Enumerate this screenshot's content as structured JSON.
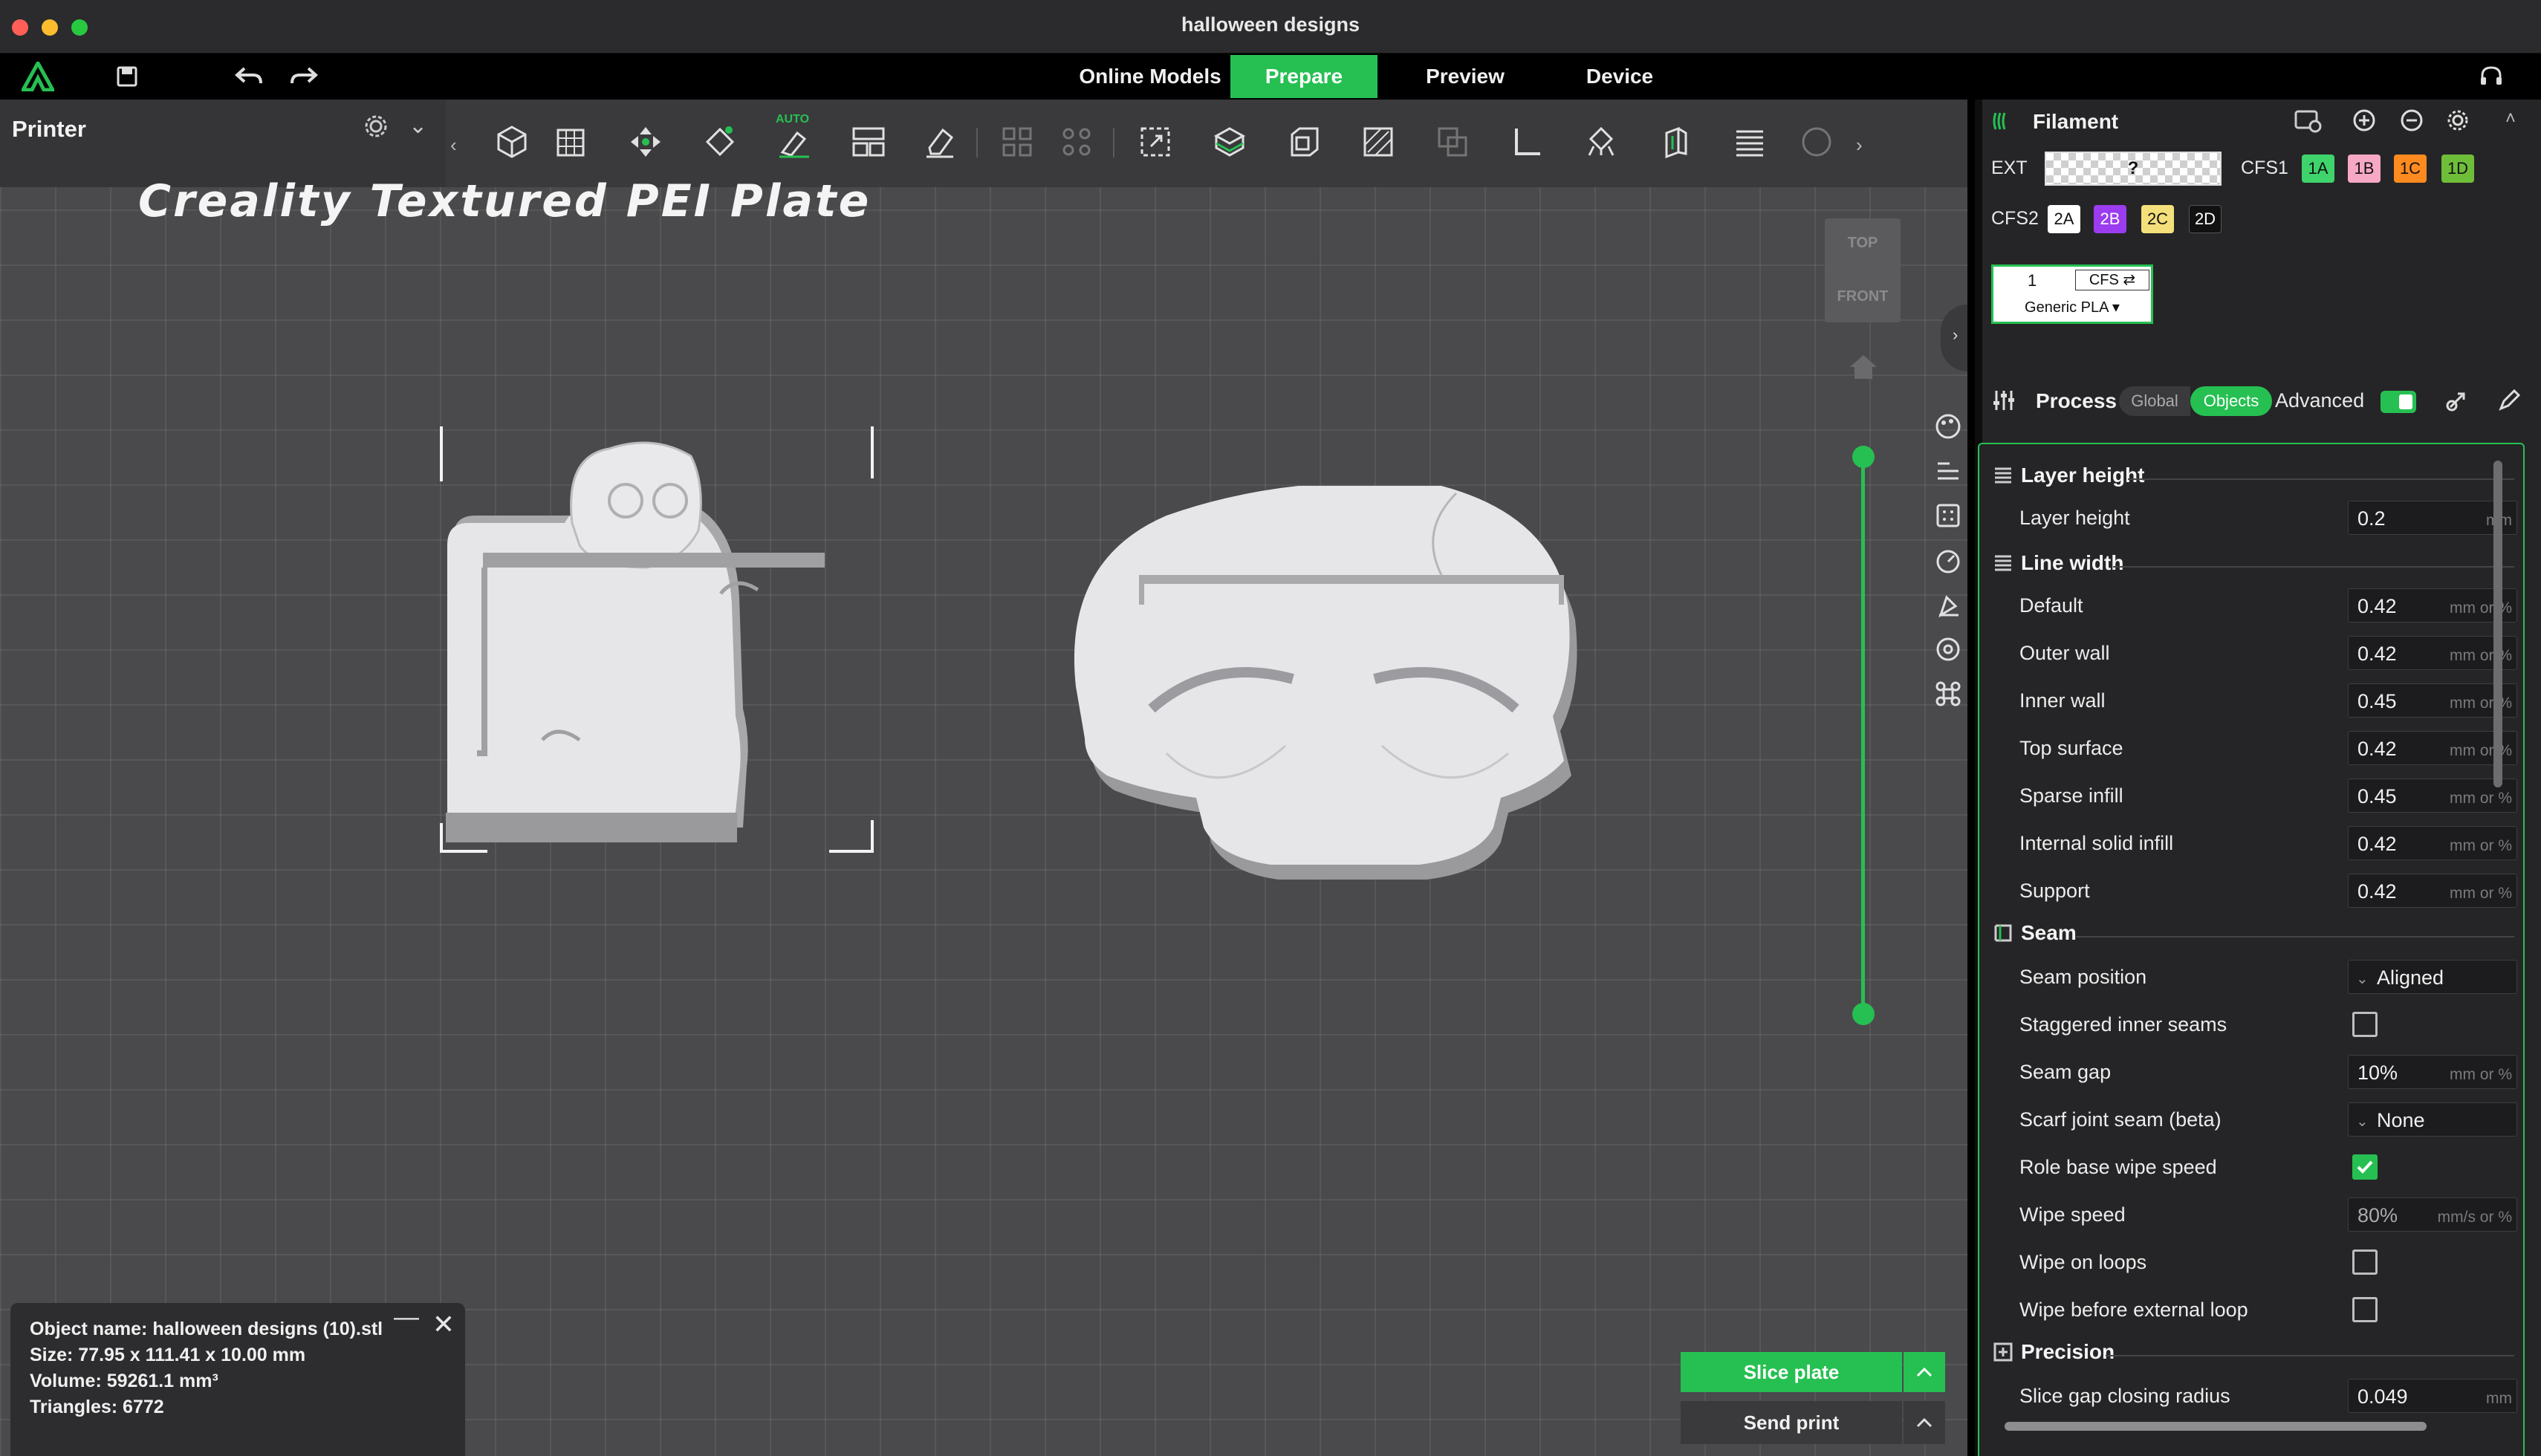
{
  "window": {
    "title": "halloween designs"
  },
  "menubar": {
    "tabs": [
      {
        "label": "Online Models",
        "active": false
      },
      {
        "label": "Prepare",
        "active": true
      },
      {
        "label": "Preview",
        "active": false
      },
      {
        "label": "Device",
        "active": false
      }
    ]
  },
  "printer": {
    "label": "Printer"
  },
  "plate": {
    "name": "Creality Textured PEI Plate"
  },
  "toolbar": {
    "auto_badge": "AUTO"
  },
  "view_cube": {
    "top": "TOP",
    "front": "FRONT"
  },
  "object_info": {
    "name": "Object name: halloween designs (10).stl",
    "size": "Size: 77.95 x 111.41 x 10.00 mm",
    "volume": "Volume: 59261.1 mm³",
    "triangles": "Triangles: 6772"
  },
  "actions": {
    "slice": "Slice plate",
    "send": "Send print"
  },
  "filament": {
    "title": "Filament",
    "ext_label": "EXT",
    "ext_value": "?",
    "cfs1_label": "CFS1",
    "cfs1_slots": [
      {
        "id": "1A",
        "color": "#3fd36b"
      },
      {
        "id": "1B",
        "color": "#f7a8c4"
      },
      {
        "id": "1C",
        "color": "#ff8a1f"
      },
      {
        "id": "1D",
        "color": "#6fbe3a"
      }
    ],
    "cfs2_label": "CFS2",
    "cfs2_slots": [
      {
        "id": "2A",
        "color": "#ffffff"
      },
      {
        "id": "2B",
        "color": "#9b3cf0"
      },
      {
        "id": "2C",
        "color": "#f4e07a"
      },
      {
        "id": "2D",
        "color": "#111111"
      }
    ],
    "card": {
      "number": "1",
      "cfs": "CFS ⇄",
      "name": "Generic PLA ▾"
    }
  },
  "process": {
    "title": "Process",
    "global": "Global",
    "objects": "Objects",
    "advanced": "Advanced",
    "sections": {
      "layer_height": "Layer height",
      "line_width": "Line width",
      "seam": "Seam",
      "precision": "Precision"
    },
    "rows": {
      "layer_height": {
        "label": "Layer height",
        "value": "0.2",
        "unit": "mm"
      },
      "default": {
        "label": "Default",
        "value": "0.42",
        "unit": "mm or %"
      },
      "outer_wall": {
        "label": "Outer wall",
        "value": "0.42",
        "unit": "mm or %"
      },
      "inner_wall": {
        "label": "Inner wall",
        "value": "0.45",
        "unit": "mm or %"
      },
      "top_surface": {
        "label": "Top surface",
        "value": "0.42",
        "unit": "mm or %"
      },
      "sparse_infill": {
        "label": "Sparse infill",
        "value": "0.45",
        "unit": "mm or %"
      },
      "internal_solid_infill": {
        "label": "Internal solid infill",
        "value": "0.42",
        "unit": "mm or %"
      },
      "support": {
        "label": "Support",
        "value": "0.42",
        "unit": "mm or %"
      },
      "seam_position": {
        "label": "Seam position",
        "value": "Aligned"
      },
      "staggered_inner_seams": {
        "label": "Staggered inner seams",
        "checked": false
      },
      "seam_gap": {
        "label": "Seam gap",
        "value": "10%",
        "unit": "mm or %"
      },
      "scarf_joint_seam": {
        "label": "Scarf joint seam (beta)",
        "value": "None"
      },
      "role_base_wipe_speed": {
        "label": "Role base wipe speed",
        "checked": true
      },
      "wipe_speed": {
        "label": "Wipe speed",
        "value": "80%",
        "unit": "mm/s or %"
      },
      "wipe_on_loops": {
        "label": "Wipe on loops",
        "checked": false
      },
      "wipe_before_external_loop": {
        "label": "Wipe before external loop",
        "checked": false
      },
      "slice_gap_closing_radius": {
        "label": "Slice gap closing radius",
        "value": "0.049",
        "unit": "mm"
      }
    }
  },
  "colors": {
    "accent": "#26c052",
    "panel": "#252527",
    "viewport": "#4a4a4d"
  }
}
